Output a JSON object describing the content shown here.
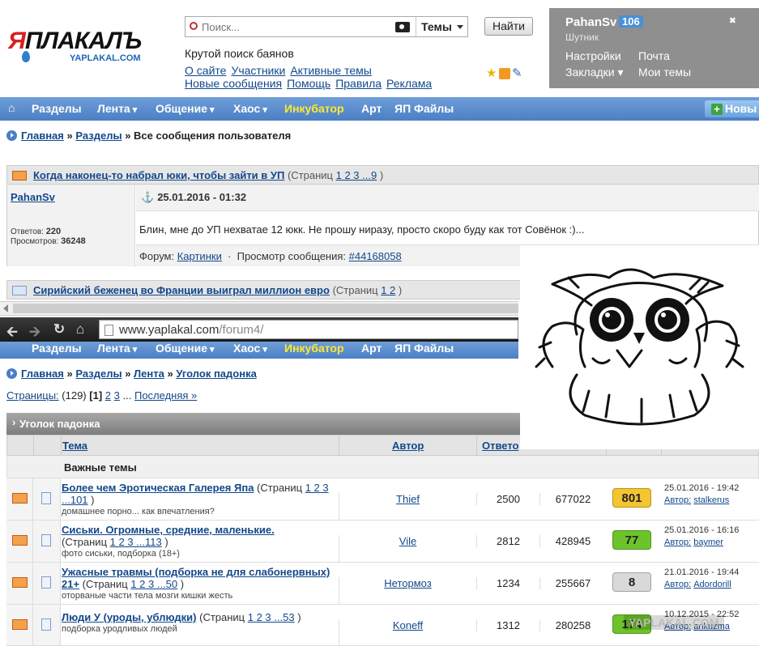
{
  "logo": {
    "main_a": "Я",
    "main_b": "ПЛАКАЛЪ",
    "sub": "YAPLAKAL.COM"
  },
  "search": {
    "placeholder": "Поиск...",
    "scope": "Темы",
    "button": "Найти"
  },
  "tagline": "Крутой поиск баянов",
  "toplinks": [
    "О сайте",
    "Участники",
    "Активные темы",
    "Новые сообщения",
    "Помощь",
    "Правила",
    "Реклама"
  ],
  "user": {
    "name": "PahanSv",
    "reputation": "106",
    "rank": "Шутник",
    "links": [
      "Настройки",
      "Почта",
      "Закладки",
      "Мои темы"
    ]
  },
  "nav": {
    "items": [
      "Разделы",
      "Лента",
      "Общение",
      "Хаос",
      "Инкубатор",
      "Арт",
      "ЯП Файлы"
    ],
    "new_button": "Новы"
  },
  "crumb1": {
    "items": [
      "Главная",
      "Разделы"
    ],
    "current": "Все сообщения пользователя",
    "sep": "»"
  },
  "topic1": {
    "title": "Когда наконец-то набрал юки, чтобы зайти в УП",
    "pages_prefix": "(Страниц",
    "pages": "1 2 3 ...9",
    "pages_suffix": ")"
  },
  "post": {
    "author": "PahanSv",
    "replies_label": "Ответов:",
    "replies": "220",
    "views_label": "Просмотров:",
    "views": "36248",
    "date": "25.01.2016 - 01:32",
    "message": "Блин, мне до УП нехватае 12 юкк. Не прошу ниразу, просто скоро буду как тот Совёнок :)...",
    "forum_label": "Форум:",
    "forum": "Картинки",
    "view_label": "Просмотр сообщения:",
    "view_link": "#44168058"
  },
  "topic2": {
    "title": "Сирийский беженец во Франции выиграл миллион евро",
    "pages_prefix": "(Страниц",
    "pages": "1 2",
    "pages_suffix": ")"
  },
  "browser": {
    "url_host": "www.yaplakal.com",
    "url_path": "/forum4/"
  },
  "crumb2": {
    "items": [
      "Главная",
      "Разделы",
      "Лента",
      "Уголок падонка"
    ],
    "sep": "»"
  },
  "paging": {
    "label": "Страницы:",
    "count": "(129)",
    "current": "[1]",
    "p2": "2",
    "p3": "3",
    "dots": "...",
    "last": "Последняя »"
  },
  "section": {
    "title": "Уголок падонка"
  },
  "columns": {
    "topic": "Тема",
    "author": "Автор",
    "replies": "Ответо"
  },
  "important": "Важные темы",
  "rows": [
    {
      "title": "Более чем Эротическая Галерея Япа",
      "pages_prefix": " (Страниц ",
      "pages": "1 2 3 ...101",
      "pages_suffix": " )",
      "desc": "домашнее порно... как впечатления?",
      "author": "Thief",
      "replies": "2500",
      "views": "677022",
      "rating": "801",
      "date": "25.01.2016 - 19:42",
      "by_label": "Автор:",
      "by": "stalkerus",
      "rating_color": "#f4c531"
    },
    {
      "title": "Сиськи. Огромные, средние, маленькие.",
      "pages_prefix": "(Страниц ",
      "pages": "1 2 3 ...113",
      "pages_suffix": " )",
      "desc": "фото сиськи, подборка (18+)",
      "author": "Vile",
      "replies": "2812",
      "views": "428945",
      "rating": "77",
      "date": "25.01.2016 - 16:16",
      "by_label": "Автор:",
      "by": "baymer",
      "rating_color": "#6cc42a"
    },
    {
      "title": "Ужасные травмы (подборка не для слабонервных) 21+",
      "pages_prefix": " (Страниц ",
      "pages": "1 2 3 ...50",
      "pages_suffix": " )",
      "desc": "оторваные части тела мозги кишки жесть",
      "author": "Нетормоз",
      "replies": "1234",
      "views": "255667",
      "rating": "8",
      "date": "21.01.2016 - 19:44",
      "by_label": "Автор:",
      "by": "Adordorill",
      "rating_color": "#d9d9d9"
    },
    {
      "title": "Люди У (уроды, ублюдки)",
      "pages_prefix": " (Страниц ",
      "pages": "1 2 3 ...53",
      "pages_suffix": " )",
      "desc": "подборка уродливых людей",
      "author": "Koneff",
      "replies": "1312",
      "views": "280258",
      "rating": "174",
      "date": "10.12.2015 - 22:52",
      "by_label": "Автор:",
      "by": "ankuzma",
      "rating_color": "#6cc42a"
    }
  ],
  "watermark": "YAPLAKAL.COM",
  "icons": [
    "search-icon",
    "camera-icon",
    "star-icon",
    "rss-icon",
    "pen-icon",
    "exit-icon",
    "home-icon",
    "envelope-icon",
    "anchor-icon",
    "document-icon",
    "back-icon",
    "forward-icon",
    "reload-icon"
  ]
}
